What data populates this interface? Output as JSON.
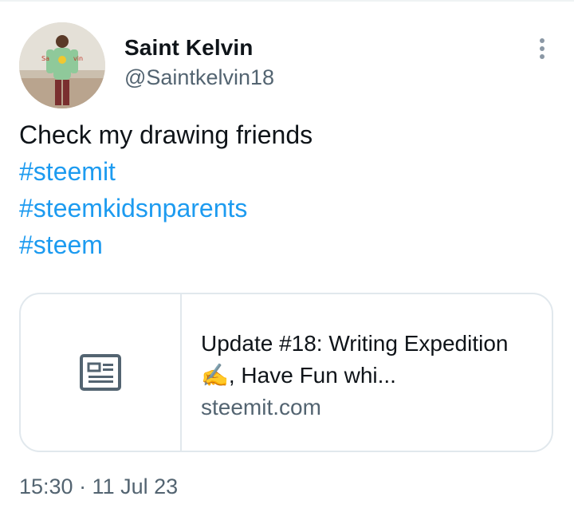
{
  "author": {
    "name": "Saint Kelvin",
    "handle": "@Saintkelvin18",
    "avatar_text": "Saint Kelvin"
  },
  "tweet": {
    "text": "Check my drawing friends",
    "hashtags": [
      "#steemit",
      "#steemkidsnparents",
      "#steem"
    ]
  },
  "link_card": {
    "title": "Update #18: Writing Expedition ✍️, Have Fun whi...",
    "domain": "steemit.com",
    "icon": "news-article-icon"
  },
  "timestamp": "15:30 · 11 Jul 23",
  "menu": {
    "icon": "more-vertical-icon"
  },
  "colors": {
    "link": "#1d9bf0",
    "secondary_text": "#536471",
    "border": "#e1e8ed"
  }
}
